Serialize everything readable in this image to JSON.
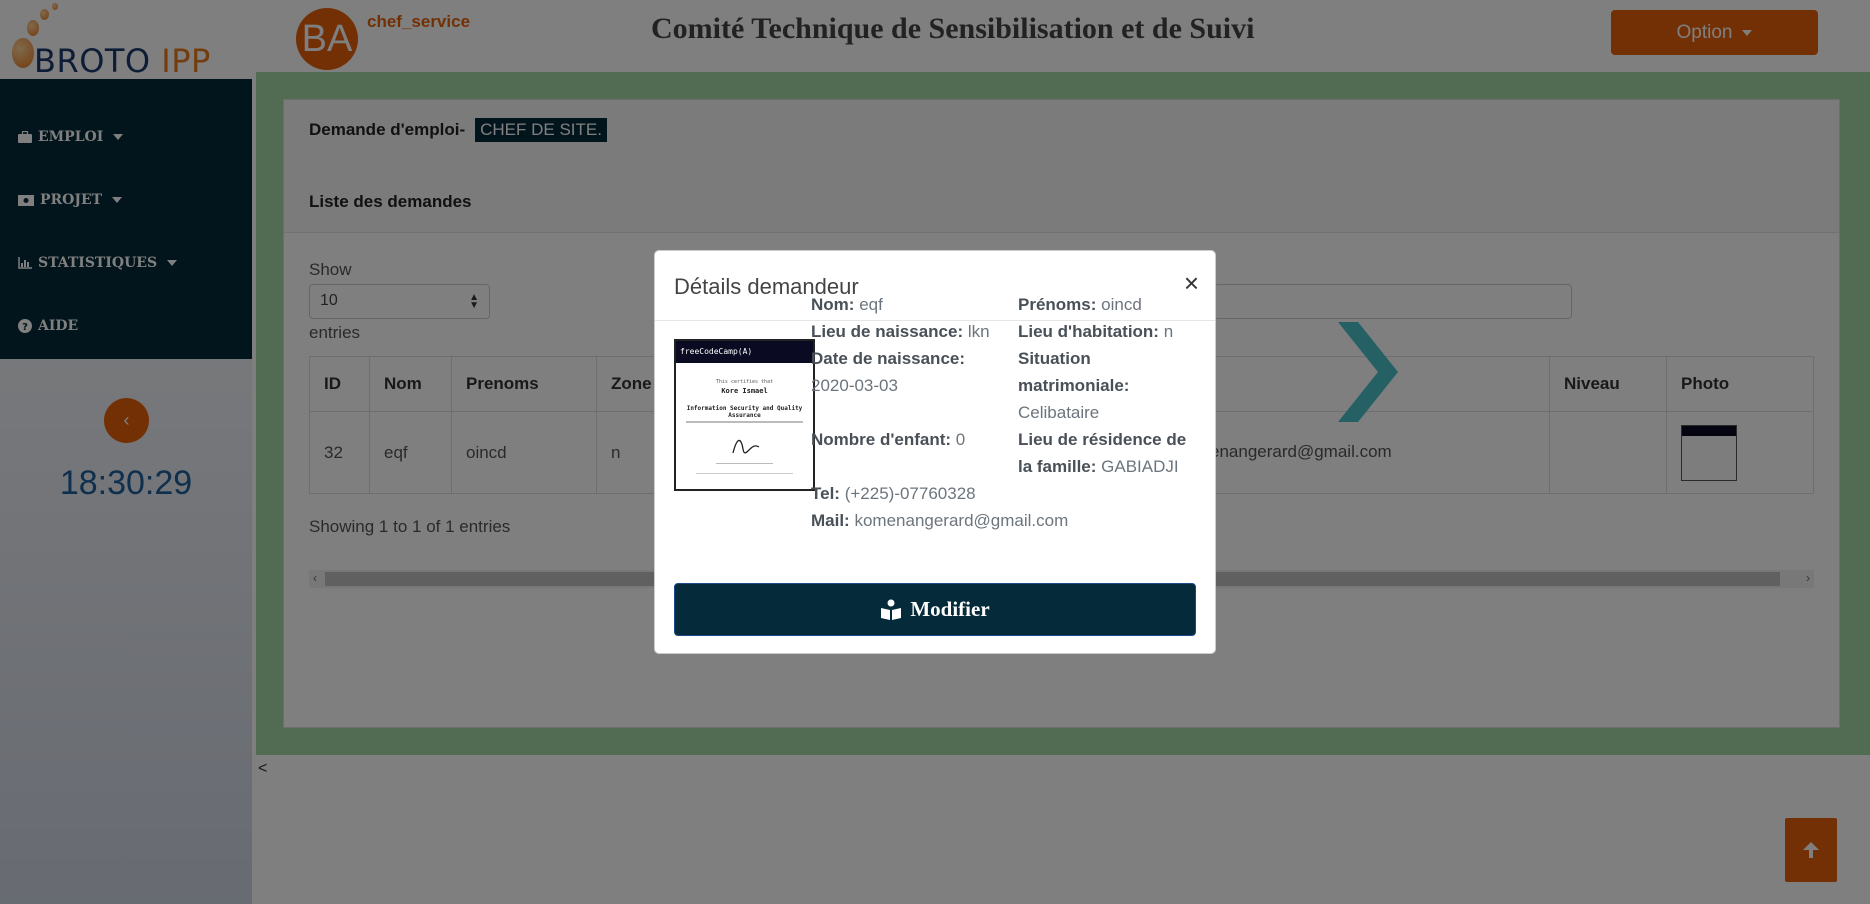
{
  "header": {
    "logo_brand": "BROTO",
    "logo_suffix": "IPP",
    "avatar_initials": "BA",
    "username": "chef_service",
    "app_title": "Comité Technique de Sensibilisation et de Suivi",
    "option_label": "Option"
  },
  "sidebar": {
    "items": [
      {
        "label": "EMPLOI",
        "icon": "briefcase-icon"
      },
      {
        "label": "PROJET",
        "icon": "money-icon"
      },
      {
        "label": "STATISTIQUES",
        "icon": "chart-icon"
      },
      {
        "label": "AIDE",
        "icon": "question-circle-icon"
      }
    ],
    "clock": "18:30:29"
  },
  "main": {
    "heading": "Demande d'emploi-",
    "job_tag": "CHEF DE SITE.",
    "list_title": "Liste des demandes",
    "show_label": "Show",
    "page_size": "10",
    "entries_label": "entries",
    "columns": [
      "ID",
      "Nom",
      "Prenoms",
      "Zone",
      "Niveau",
      "Photo"
    ],
    "rows": [
      {
        "id": "32",
        "nom": "eqf",
        "prenoms": "oincd",
        "zone": "n",
        "mail_fragment": "enangerard@gmail.com",
        "niveau": ""
      }
    ],
    "showing": "Showing 1 to 1 of 1 entries",
    "lt_mark": "<"
  },
  "modal": {
    "title": "Détails demandeur",
    "close": "×",
    "certificate": {
      "brand": "freeCodeCamp(A)",
      "recipient": "Kore Ismael",
      "course_line1": "Information Security and Quality Assurance"
    },
    "fields": {
      "nom_label": "Nom:",
      "nom": "eqf",
      "prenoms_label": "Prénoms:",
      "prenoms": "oincd",
      "lieu_naissance_label": "Lieu de naissance:",
      "lieu_naissance": "lkn",
      "lieu_habitation_label": "Lieu d'habitation:",
      "lieu_habitation": "n",
      "date_naissance_label": "Date de naissance:",
      "date_naissance": "2020-03-03",
      "situation_label_1": "Situation",
      "situation_label_2": "matrimoniale:",
      "situation": "Celibataire",
      "nb_enfant_label": "Nombre d'enfant:",
      "nb_enfant": "0",
      "residence_label_1": "Lieu de résidence de",
      "residence_label_2": "la famille:",
      "residence": "GABIADJI",
      "tel_label": "Tel:",
      "tel": "(+225)-07760328",
      "mail_label": "Mail:",
      "mail": "komenangerard@gmail.com"
    },
    "modifier_label": "Modifier"
  },
  "colors": {
    "accent": "#e8600a",
    "navy": "#052a3a",
    "green_frame": "#a5d6a7",
    "clock": "#1d5f9a"
  }
}
